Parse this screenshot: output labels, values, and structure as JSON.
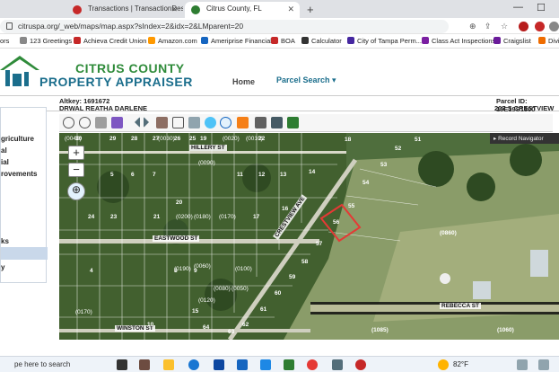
{
  "browser": {
    "tabs": [
      {
        "title": "Transactions | TransactionDesk",
        "active": false
      },
      {
        "title": "Citrus County, FL",
        "active": true
      }
    ],
    "url": "citruspa.org/_web/maps/map.aspx?sIndex=2&idx=2&LMparent=20",
    "bookmarks": [
      "ors",
      "123 Greetings",
      "Achieva Credit Union",
      "Amazon.com",
      "Ameriprise Financial",
      "BOA",
      "Calculator",
      "City of Tampa Perm...",
      "Class Act Inspections",
      "Craigslist",
      "Divi"
    ]
  },
  "header": {
    "brand_line1": "CITRUS COUNTY",
    "brand_line2": "PROPERTY APPRAISER",
    "nav_home": "Home",
    "nav_parcel": "Parcel Search ▾"
  },
  "parcel": {
    "altkey": "Altkey: 1691672",
    "owner": "DRWAL REATHA DARLENE",
    "parcel_id": "Parcel ID: 19E19S1300",
    "address": "207 S CRESTVIEW AVE"
  },
  "sidebar": {
    "items": [
      "griculture",
      "al",
      "ial",
      "rovements",
      "ks",
      "y"
    ]
  },
  "map": {
    "record_navigator": "▸ Record Navigator",
    "zoom_in": "+",
    "zoom_out": "−",
    "streets": [
      "HILLERY ST",
      "EASTWOOD ST",
      "CRESTVIEW AVE",
      "REBECCA ST",
      "WINSTON ST"
    ],
    "lot_numbers": [
      "30",
      "29",
      "28",
      "27",
      "26",
      "25",
      "24",
      "23",
      "22",
      "21",
      "20",
      "19",
      "18",
      "52",
      "51",
      "53",
      "54",
      "55",
      "56",
      "57",
      "58",
      "59",
      "60",
      "61",
      "62",
      "63",
      "64",
      "3",
      "4",
      "5",
      "6",
      "7",
      "8",
      "9",
      "10",
      "11",
      "12",
      "13",
      "14",
      "15",
      "16",
      "17"
    ],
    "parcel_ids": [
      "(0200)",
      "(0190)",
      "(0180)",
      "(0170)",
      "(0100)",
      "(0120)",
      "(0090)",
      "(0060)",
      "(0080)",
      "(0050)",
      "(0040)",
      "(0030)",
      "(0020)",
      "(0010)",
      "(0860)",
      "(1085)",
      "(1060)",
      "(0170)"
    ]
  },
  "taskbar": {
    "search_placeholder": "pe here to search",
    "weather": "82°F"
  }
}
